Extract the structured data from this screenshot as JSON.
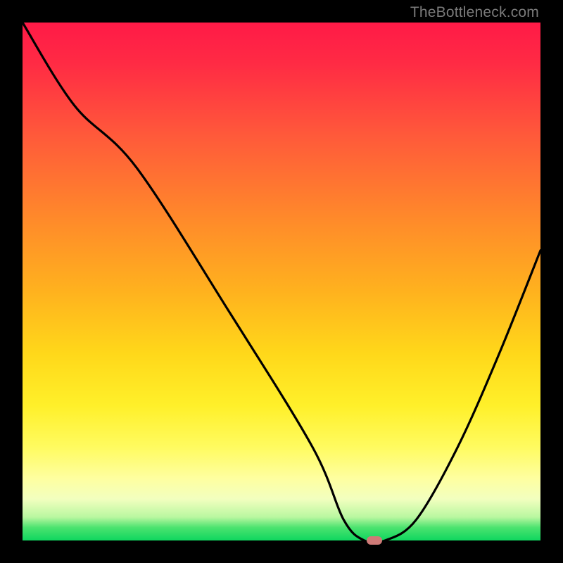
{
  "watermark": "TheBottleneck.com",
  "colors": {
    "gradient_top": "#ff1a47",
    "gradient_mid": "#ffd81a",
    "gradient_bottom": "#0fd65f",
    "marker": "#cf7a77",
    "curve": "#000000",
    "frame": "#000000"
  },
  "chart_data": {
    "type": "line",
    "title": "",
    "xlabel": "",
    "ylabel": "",
    "xlim": [
      0,
      100
    ],
    "ylim": [
      0,
      100
    ],
    "grid": false,
    "legend": false,
    "series": [
      {
        "name": "bottleneck-curve",
        "x": [
          0,
          10,
          22,
          40,
          56,
          62,
          66,
          70,
          76,
          84,
          92,
          100
        ],
        "y": [
          100,
          84,
          72,
          44,
          18,
          4,
          0,
          0,
          4,
          18,
          36,
          56
        ]
      }
    ],
    "marker": {
      "x": 68,
      "y": 0
    }
  }
}
